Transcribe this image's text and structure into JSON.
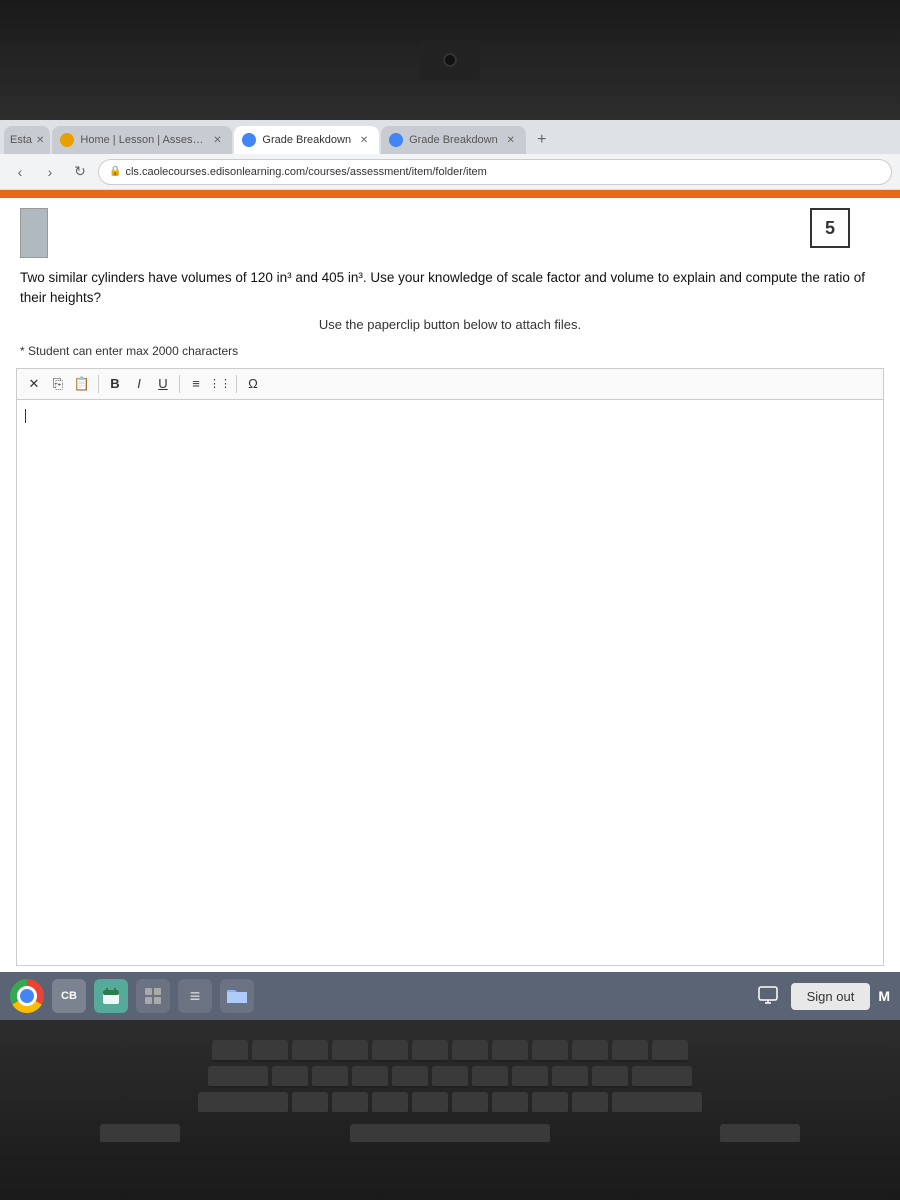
{
  "browser": {
    "tabs": [
      {
        "id": "tab-extra",
        "label": "Esta",
        "active": false,
        "favicon": "blue"
      },
      {
        "id": "tab-home",
        "label": "Home | Lesson | Assessment I",
        "active": false,
        "favicon": "orange"
      },
      {
        "id": "tab-grade1",
        "label": "Grade Breakdown",
        "active": true,
        "favicon": "blue"
      },
      {
        "id": "tab-grade2",
        "label": "Grade Breakdown",
        "active": false,
        "favicon": "blue"
      }
    ],
    "url": "cls.caolecourses.edisonlearning.com/courses/assessment/item/folder/item",
    "new_tab_label": "+"
  },
  "page": {
    "question_number": "5",
    "question_text": "Two similar cylinders have volumes of 120 in³ and 405 in³. Use your knowledge of scale factor and volume to explain and compute the ratio of their heights?",
    "instruction": "Use the paperclip button below to attach files.",
    "char_limit_label": "* Student can enter max 2000 characters",
    "toolbar": {
      "buttons": [
        "✕",
        "⎘",
        "📋",
        "B",
        "I",
        "U",
        "≡",
        "⋮⋮",
        "Ω"
      ]
    },
    "editor_content": ""
  },
  "taskbar": {
    "sign_out_label": "Sign out",
    "icons": [
      "chrome",
      "cb",
      "calendar",
      "grid",
      "doc",
      "folder"
    ],
    "m_label": "M"
  }
}
